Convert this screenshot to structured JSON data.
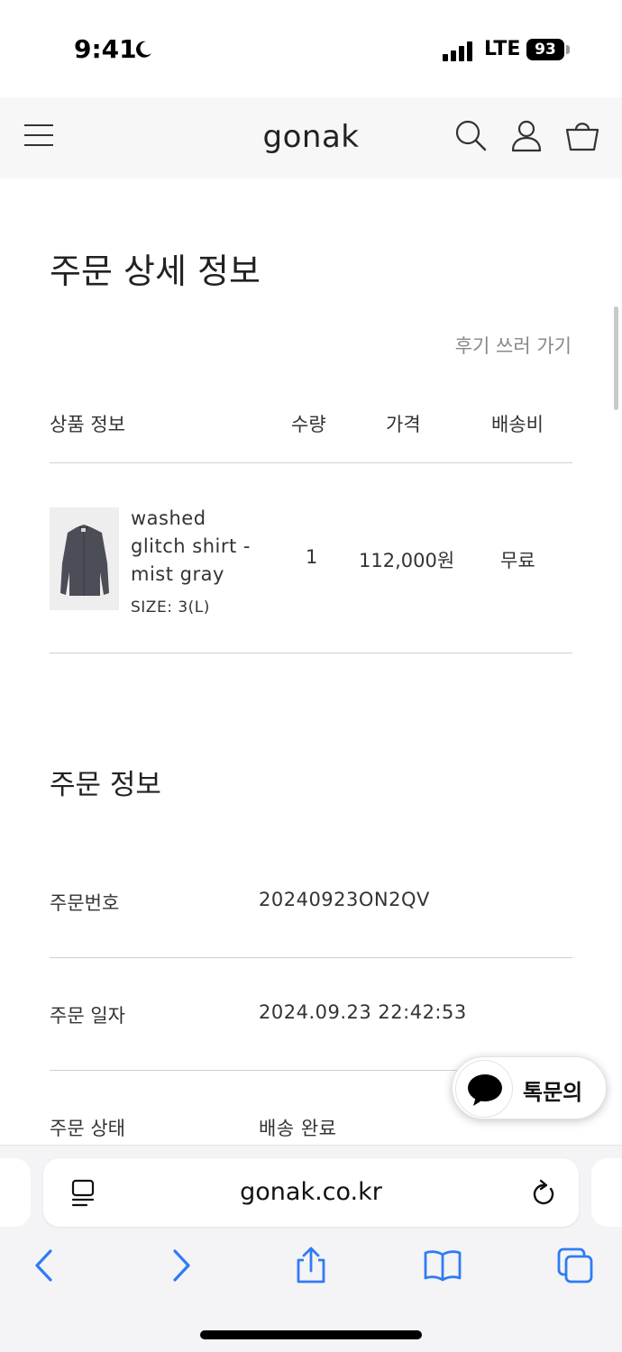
{
  "status_bar": {
    "time": "9:41",
    "network": "LTE",
    "battery": "93"
  },
  "header": {
    "logo": "gonak",
    "icons": [
      "menu-icon",
      "search-icon",
      "user-icon",
      "cart-icon"
    ]
  },
  "page": {
    "title": "주문 상세 정보",
    "review_link": "후기 쓰러 가기"
  },
  "order_table": {
    "headers": {
      "product": "상품 정보",
      "qty": "수량",
      "price": "가격",
      "shipping": "배송비"
    },
    "items": [
      {
        "name": "washed glitch shirt - mist gray",
        "size": "SIZE: 3(L)",
        "qty": "1",
        "price": "112,000원",
        "shipping": "무료"
      }
    ]
  },
  "order_info": {
    "title": "주문 정보",
    "rows": [
      {
        "label": "주문번호",
        "value": "20240923ON2QV"
      },
      {
        "label": "주문 일자",
        "value": "2024.09.23 22:42:53"
      },
      {
        "label": "주문 상태",
        "value": "배송 완료"
      }
    ]
  },
  "chat_button": {
    "label": "톡문의",
    "icon": "chat-bubble-icon"
  },
  "browser": {
    "url": "gonak.co.kr",
    "toolbar_icons": [
      "back-icon",
      "forward-icon",
      "share-icon",
      "bookmarks-icon",
      "tabs-icon"
    ]
  },
  "colors": {
    "accent_ios": "#2f7bf5",
    "header_bg": "#f7f7f7",
    "divider": "#cfcfcf"
  }
}
